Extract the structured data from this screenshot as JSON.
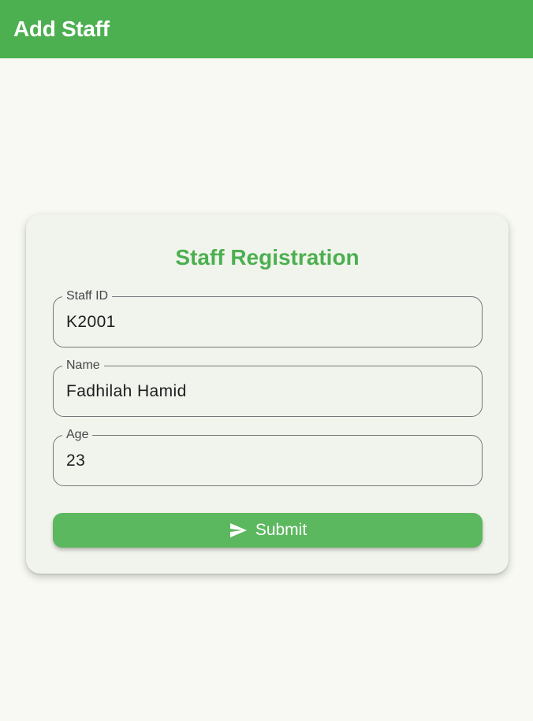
{
  "appbar": {
    "title": "Add Staff"
  },
  "form": {
    "title": "Staff Registration",
    "fields": [
      {
        "label": "Staff ID",
        "value": "K2001"
      },
      {
        "label": "Name",
        "value": "Fadhilah Hamid"
      },
      {
        "label": "Age",
        "value": "23"
      }
    ],
    "submit": {
      "label": "Submit",
      "icon": "send-icon"
    }
  },
  "colors": {
    "primary": "#4caf50",
    "button": "#5cb85f",
    "background": "#f7f9f2",
    "card": "#f1f4ec",
    "outline": "#74777a"
  }
}
